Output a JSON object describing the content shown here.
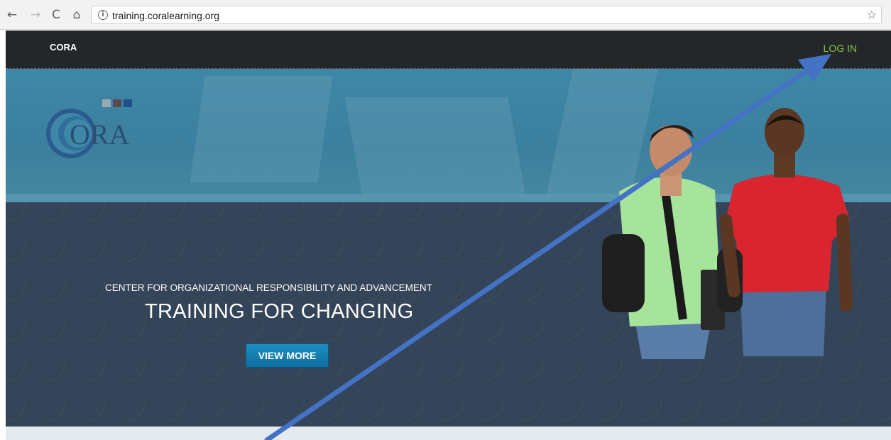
{
  "browser": {
    "url": "training.coralearning.org",
    "back_glyph": "←",
    "forward_glyph": "→",
    "reload_glyph": "C",
    "home_glyph": "⌂",
    "info_glyph": "i",
    "star_glyph": "☆"
  },
  "header": {
    "brand": "CORA",
    "login_label": "LOG IN"
  },
  "logo": {
    "text": "ORA"
  },
  "hero": {
    "tagline": "CENTER FOR ORGANIZATIONAL RESPONSIBILITY AND ADVANCEMENT",
    "headline": "TRAINING FOR CHANGING",
    "button_label": "VIEW MORE"
  },
  "colors": {
    "topbar": "#24272a",
    "login": "#8dc63f",
    "hero_top": "#3e87a6",
    "hero_bottom": "#354559",
    "button": "#1e8ec2",
    "arrow": "#4472c4"
  }
}
